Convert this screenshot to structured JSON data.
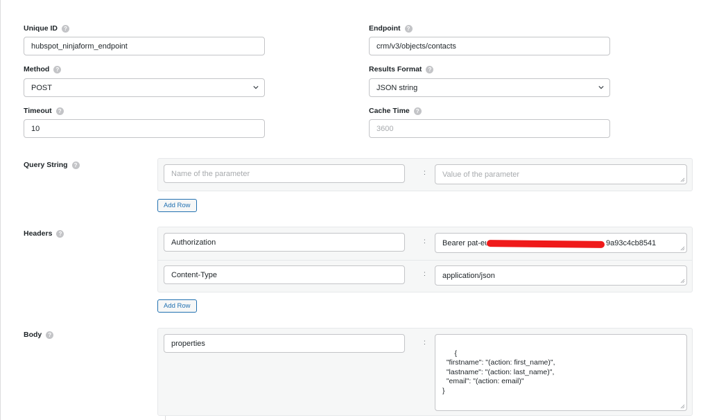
{
  "fields": {
    "unique_id": {
      "label": "Unique ID",
      "value": "hubspot_ninjaform_endpoint"
    },
    "endpoint": {
      "label": "Endpoint",
      "value": "crm/v3/objects/contacts"
    },
    "method": {
      "label": "Method",
      "value": "POST"
    },
    "results_format": {
      "label": "Results Format",
      "value": "JSON string"
    },
    "timeout": {
      "label": "Timeout",
      "value": "10"
    },
    "cache_time": {
      "label": "Cache Time",
      "placeholder": "3600"
    }
  },
  "help_glyph": "?",
  "separator": ":",
  "query_string": {
    "label": "Query String",
    "name_placeholder": "Name of the parameter",
    "value_placeholder": "Value of the parameter",
    "add_row": "Add Row"
  },
  "headers": {
    "label": "Headers",
    "rows": [
      {
        "name": "Authorization",
        "value_start": "Bearer pat-eu1",
        "value_end": "9a93c4cb8541"
      },
      {
        "name": "Content-Type",
        "value": "application/json"
      }
    ],
    "add_row": "Add Row"
  },
  "body": {
    "label": "Body",
    "rows": [
      {
        "name": "properties",
        "value": "{\n  \"firstname\": \"(action: first_name)\",\n  \"lastname\": \"(action: last_name)\",\n  \"email\": \"(action: email)\"\n}"
      }
    ]
  },
  "colors": {
    "accent": "#2271b1",
    "redaction": "#ef1a1a",
    "panel_bg": "#f6f7f7"
  }
}
